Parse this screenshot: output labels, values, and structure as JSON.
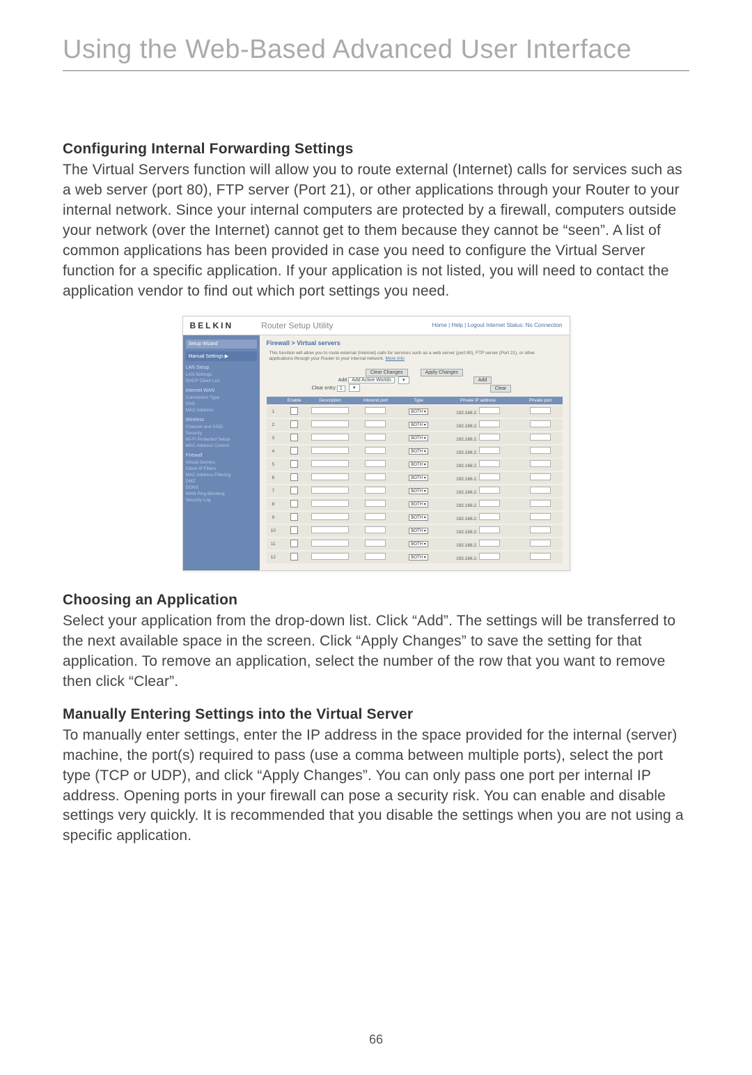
{
  "title": "Using the Web-Based Advanced User Interface",
  "page_number": "66",
  "sections": {
    "s1": {
      "heading": "Configuring Internal Forwarding Settings",
      "body": "The Virtual Servers function will allow you to route external (Internet) calls for services such as a web server (port 80), FTP server (Port 21), or other applications through your Router to your internal network. Since your internal computers are protected by a firewall, computers outside your network (over the Internet) cannot get to them because they cannot be “seen”. A list of common applications has been provided in case you need to configure the Virtual Server function for a specific application. If your application is not listed, you will need to contact the application vendor to find out which port settings you need."
    },
    "s2": {
      "heading": "Choosing an Application",
      "body": "Select your application from the drop-down list. Click “Add”. The settings will be transferred to the next available space in the screen. Click “Apply Changes” to save the setting for that application. To remove an application, select the number of the row that you want to remove then click “Clear”."
    },
    "s3": {
      "heading": "Manually Entering Settings into the Virtual Server",
      "body": "To manually enter settings, enter the IP address in the space provided for the internal (server) machine, the port(s) required to pass (use a comma between multiple ports), select the port type (TCP or UDP), and click “Apply Changes”. You can only pass one port per internal IP address. Opening ports in your firewall can pose a security risk. You can enable and disable settings very quickly. It is recommended that you disable the settings when you are not using a specific application."
    }
  },
  "screenshot": {
    "logo": "BELKIN",
    "app_title": "Router Setup Utility",
    "top_links": "Home | Help | Logout   Internet Status: No Connection",
    "breadcrumb": "Firewall > Virtual servers",
    "intro": "This function will allow you to route external (Internet) calls for services such as a web server (port 80), FTP server (Port 21), or other applications through your Router to your internal network.",
    "more_info": "More Info",
    "sidebar": {
      "wizard": "Setup Wizard",
      "manual": "Manual Settings ▶",
      "groups": [
        {
          "label": "LAN Setup",
          "items": [
            "LAN Settings",
            "DHCP Client List"
          ]
        },
        {
          "label": "Internet WAN",
          "items": [
            "Connection Type",
            "DNS",
            "MAC Address"
          ]
        },
        {
          "label": "Wireless",
          "items": [
            "Channel and SSID",
            "Security",
            "Wi-Fi Protected Setup",
            "MAC Address Control"
          ]
        },
        {
          "label": "Firewall",
          "items": [
            "Virtual Servers",
            "Client IP Filters",
            "MAC Address Filtering",
            "DMZ",
            "DDNS",
            "WAN Ping Blocking",
            "Security Log"
          ]
        }
      ]
    },
    "toolbar": {
      "clear_changes": "Clear Changes",
      "apply_changes": "Apply Changes",
      "active_worlds": "Add Active Worlds",
      "add": "Add",
      "clear_entry_label": "Clear entry",
      "clear_entry_value": "1",
      "clear": "Clear"
    },
    "table": {
      "headers": [
        "",
        "Enable",
        "Description",
        "Inbound port",
        "Type",
        "Private IP address",
        "Private port"
      ],
      "type_value": "BOTH",
      "ip_prefix": "192.168.2.",
      "row_count": 12
    }
  }
}
